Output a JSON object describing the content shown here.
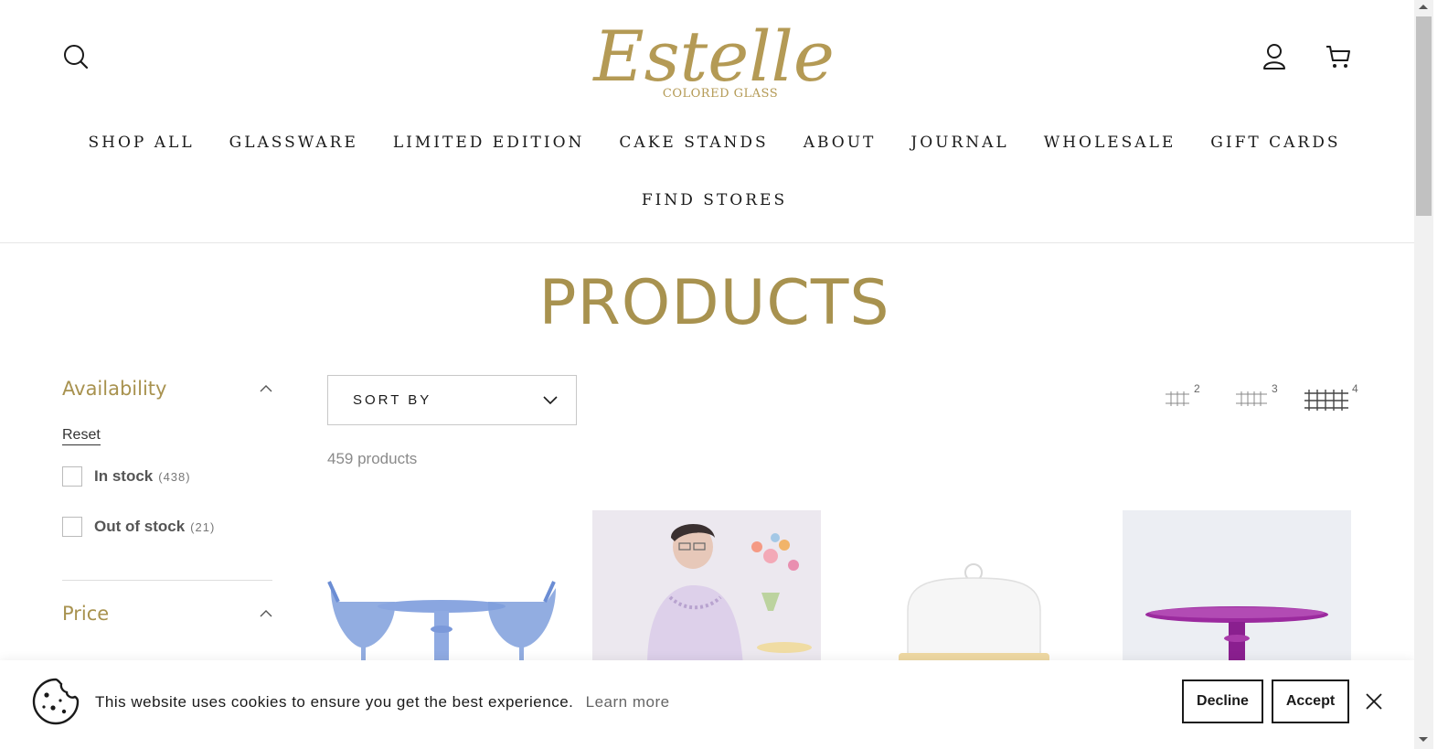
{
  "header": {
    "logo_script": "Estelle",
    "logo_sub": "COLORED GLASS",
    "nav_row1": [
      "SHOP ALL",
      "GLASSWARE",
      "LIMITED EDITION",
      "CAKE STANDS",
      "ABOUT",
      "JOURNAL",
      "WHOLESALE",
      "GIFT CARDS"
    ],
    "nav_row2": [
      "FIND STORES"
    ],
    "icons": [
      "search-icon",
      "account-icon",
      "cart-icon"
    ]
  },
  "page": {
    "title": "PRODUCTS"
  },
  "filters": {
    "availability": {
      "title": "Availability",
      "reset": "Reset",
      "options": [
        {
          "label": "In stock",
          "count": "(438)",
          "checked": false
        },
        {
          "label": "Out of stock",
          "count": "(21)",
          "checked": false
        }
      ]
    },
    "price": {
      "title": "Price"
    }
  },
  "toolbar": {
    "sort_label": "SORT BY",
    "product_count": "459 products",
    "grid_options": [
      "2",
      "3",
      "4"
    ]
  },
  "cookie_banner": {
    "message": "This website uses cookies to ensure you get the best experience.",
    "learn_more": "Learn more",
    "decline": "Decline",
    "accept": "Accept"
  },
  "colors": {
    "brand_gold": "#a8924f",
    "text": "#1a1a1a"
  }
}
